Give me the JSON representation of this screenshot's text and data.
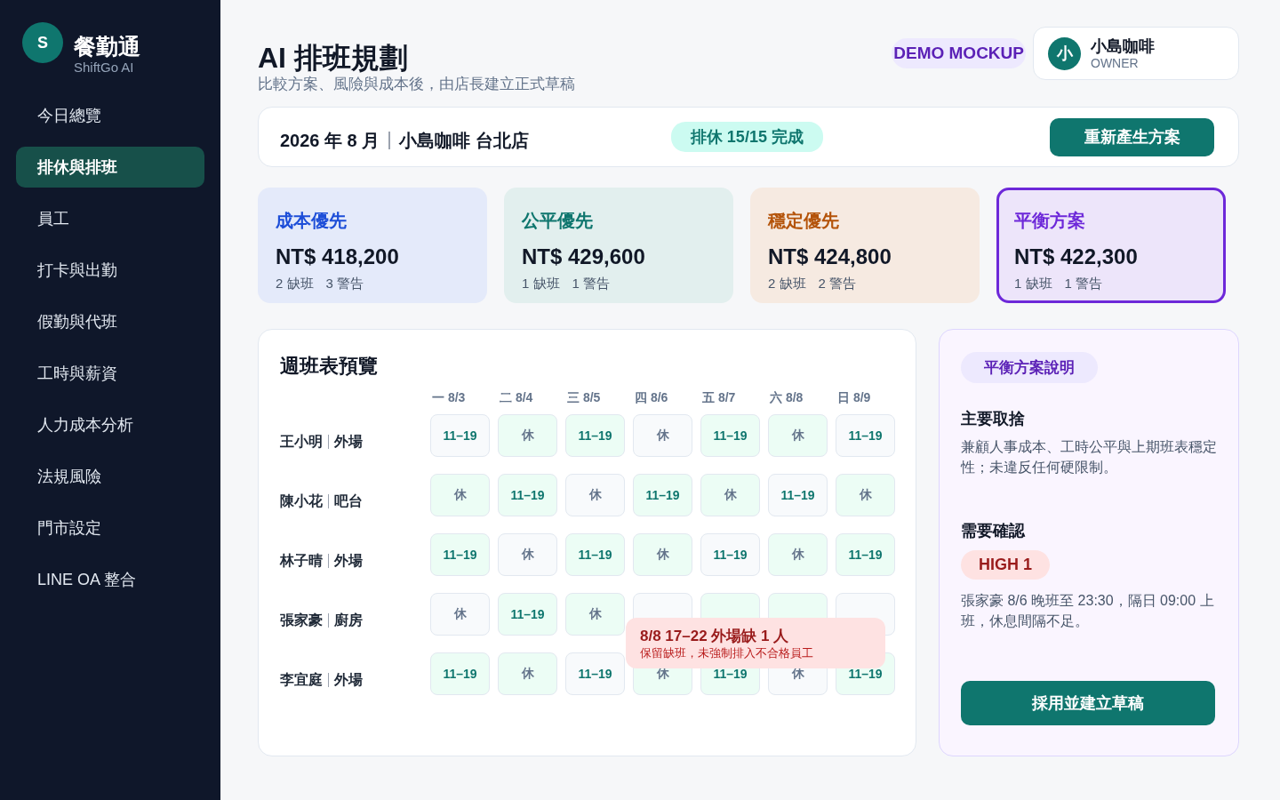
{
  "brand": {
    "logo_letter": "S",
    "name": "餐勤通",
    "subtitle": "ShiftGo AI"
  },
  "sidebar": {
    "items": [
      {
        "label": "今日總覽",
        "selected": false
      },
      {
        "label": "排休與排班",
        "selected": true
      },
      {
        "label": "員工",
        "selected": false
      },
      {
        "label": "打卡與出勤",
        "selected": false
      },
      {
        "label": "假勤與代班",
        "selected": false
      },
      {
        "label": "工時與薪資",
        "selected": false
      },
      {
        "label": "人力成本分析",
        "selected": false
      },
      {
        "label": "法規風險",
        "selected": false
      },
      {
        "label": "門市設定",
        "selected": false
      },
      {
        "label": "LINE OA 整合",
        "selected": false
      }
    ]
  },
  "header": {
    "title": "AI 排班規劃",
    "subtitle": "比較方案、風險與成本後，由店長建立正式草稿",
    "badge": "DEMO MOCKUP",
    "user": {
      "avatar_letter": "小",
      "name": "小島咖啡",
      "role": "OWNER"
    }
  },
  "context_bar": {
    "period": "2026 年 8 月",
    "store": "小島咖啡 台北店",
    "status": "排休 15/15 完成",
    "button": "重新產生方案"
  },
  "plans": [
    {
      "title": "成本優先",
      "cost": "NT$ 418,200",
      "gaps": "2 缺班",
      "warnings": "3 警告",
      "color": "#1d4ed8",
      "selected": false
    },
    {
      "title": "公平優先",
      "cost": "NT$ 429,600",
      "gaps": "1 缺班",
      "warnings": "1 警告",
      "color": "#0f766e",
      "selected": false
    },
    {
      "title": "穩定優先",
      "cost": "NT$ 424,800",
      "gaps": "2 缺班",
      "warnings": "2 警告",
      "color": "#b45309",
      "selected": false
    },
    {
      "title": "平衡方案",
      "cost": "NT$ 422,300",
      "gaps": "1 缺班",
      "warnings": "1 警告",
      "color": "#6d28d9",
      "selected": true
    }
  ],
  "schedule": {
    "title": "週班表預覽",
    "days": [
      "一 8/3",
      "二 8/4",
      "三 8/5",
      "四 8/6",
      "五 8/7",
      "六 8/8",
      "日 8/9"
    ],
    "rows": [
      {
        "name": "王小明",
        "role": "外場",
        "cells": [
          {
            "text": "11–19",
            "color": "#f8fafc"
          },
          {
            "text": "休",
            "color": "#ecfdf5"
          },
          {
            "text": "11–19",
            "color": "#ecfdf5"
          },
          {
            "text": "休",
            "color": "#f8fafc"
          },
          {
            "text": "11–19",
            "color": "#ecfdf5"
          },
          {
            "text": "休",
            "color": "#ecfdf5"
          },
          {
            "text": "11–19",
            "color": "#f8fafc"
          }
        ]
      },
      {
        "name": "陳小花",
        "role": "吧台",
        "cells": [
          {
            "text": "休",
            "color": "#ecfdf5"
          },
          {
            "text": "11–19",
            "color": "#ecfdf5"
          },
          {
            "text": "休",
            "color": "#f8fafc"
          },
          {
            "text": "11–19",
            "color": "#ecfdf5"
          },
          {
            "text": "休",
            "color": "#ecfdf5"
          },
          {
            "text": "11–19",
            "color": "#f8fafc"
          },
          {
            "text": "休",
            "color": "#ecfdf5"
          }
        ]
      },
      {
        "name": "林子晴",
        "role": "外場",
        "cells": [
          {
            "text": "11–19",
            "color": "#ecfdf5"
          },
          {
            "text": "休",
            "color": "#f8fafc"
          },
          {
            "text": "11–19",
            "color": "#ecfdf5"
          },
          {
            "text": "休",
            "color": "#ecfdf5"
          },
          {
            "text": "11–19",
            "color": "#f8fafc"
          },
          {
            "text": "休",
            "color": "#ecfdf5"
          },
          {
            "text": "11–19",
            "color": "#ecfdf5"
          }
        ]
      },
      {
        "name": "張家豪",
        "role": "廚房",
        "cells": [
          {
            "text": "休",
            "color": "#f8fafc"
          },
          {
            "text": "11–19",
            "color": "#ecfdf5"
          },
          {
            "text": "休",
            "color": "#ecfdf5"
          },
          {
            "color": "#f8fafc"
          },
          {
            "color": "#ecfdf5"
          },
          {
            "color": "#ecfdf5"
          },
          {
            "color": "#f8fafc"
          }
        ]
      },
      {
        "name": "李宜庭",
        "role": "外場",
        "cells": [
          {
            "text": "11–19",
            "color": "#ecfdf5"
          },
          {
            "text": "休",
            "color": "#ecfdf5"
          },
          {
            "text": "11–19",
            "color": "#f8fafc"
          },
          {
            "text": "休",
            "color": "#ecfdf5"
          },
          {
            "text": "11–19",
            "color": "#ecfdf5"
          },
          {
            "text": "休",
            "color": "#f8fafc"
          },
          {
            "text": "11–19",
            "color": "#ecfdf5"
          }
        ]
      }
    ],
    "alert": {
      "title": "8/8 17–22 外場缺 1 人",
      "detail": "保留缺班，未強制排入不合格員工"
    }
  },
  "explanation": {
    "tag": "平衡方案說明",
    "tradeoff_heading": "主要取捨",
    "tradeoff_text": "兼顧人事成本、工時公平與上期班表穩定性；未違反任何硬限制。",
    "confirm_heading": "需要確認",
    "severity": "HIGH 1",
    "confirm_text": "張家豪 8/6 晚班至 23:30，隔日 09:00 上班，休息間隔不足。",
    "button": "採用並建立草稿"
  }
}
